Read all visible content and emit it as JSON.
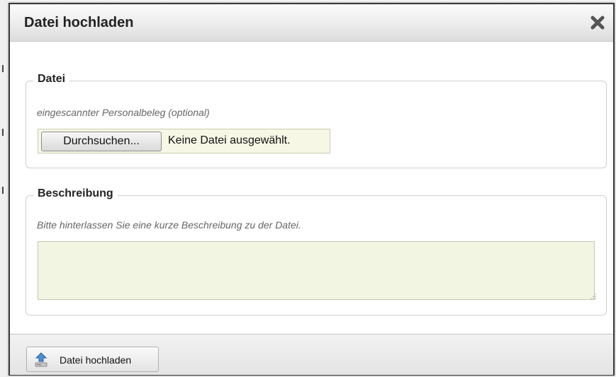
{
  "dialog": {
    "title": "Datei hochladen",
    "close_icon": "close-x-icon"
  },
  "file_section": {
    "legend": "Datei",
    "hint": "eingescannter Personalbeleg (optional)",
    "browse_label": "Durchsuchen...",
    "status": "Keine Datei ausgewählt."
  },
  "description_section": {
    "legend": "Beschreibung",
    "hint": "Bitte hinterlassen Sie eine kurze Beschreibung zu der Datei.",
    "value": ""
  },
  "footer": {
    "upload_label": "Datei hochladen",
    "upload_icon": "upload-arrow-icon"
  },
  "colors": {
    "input_bg": "#f1f5e2",
    "title_text": "#222222",
    "hint_text": "#666666"
  }
}
